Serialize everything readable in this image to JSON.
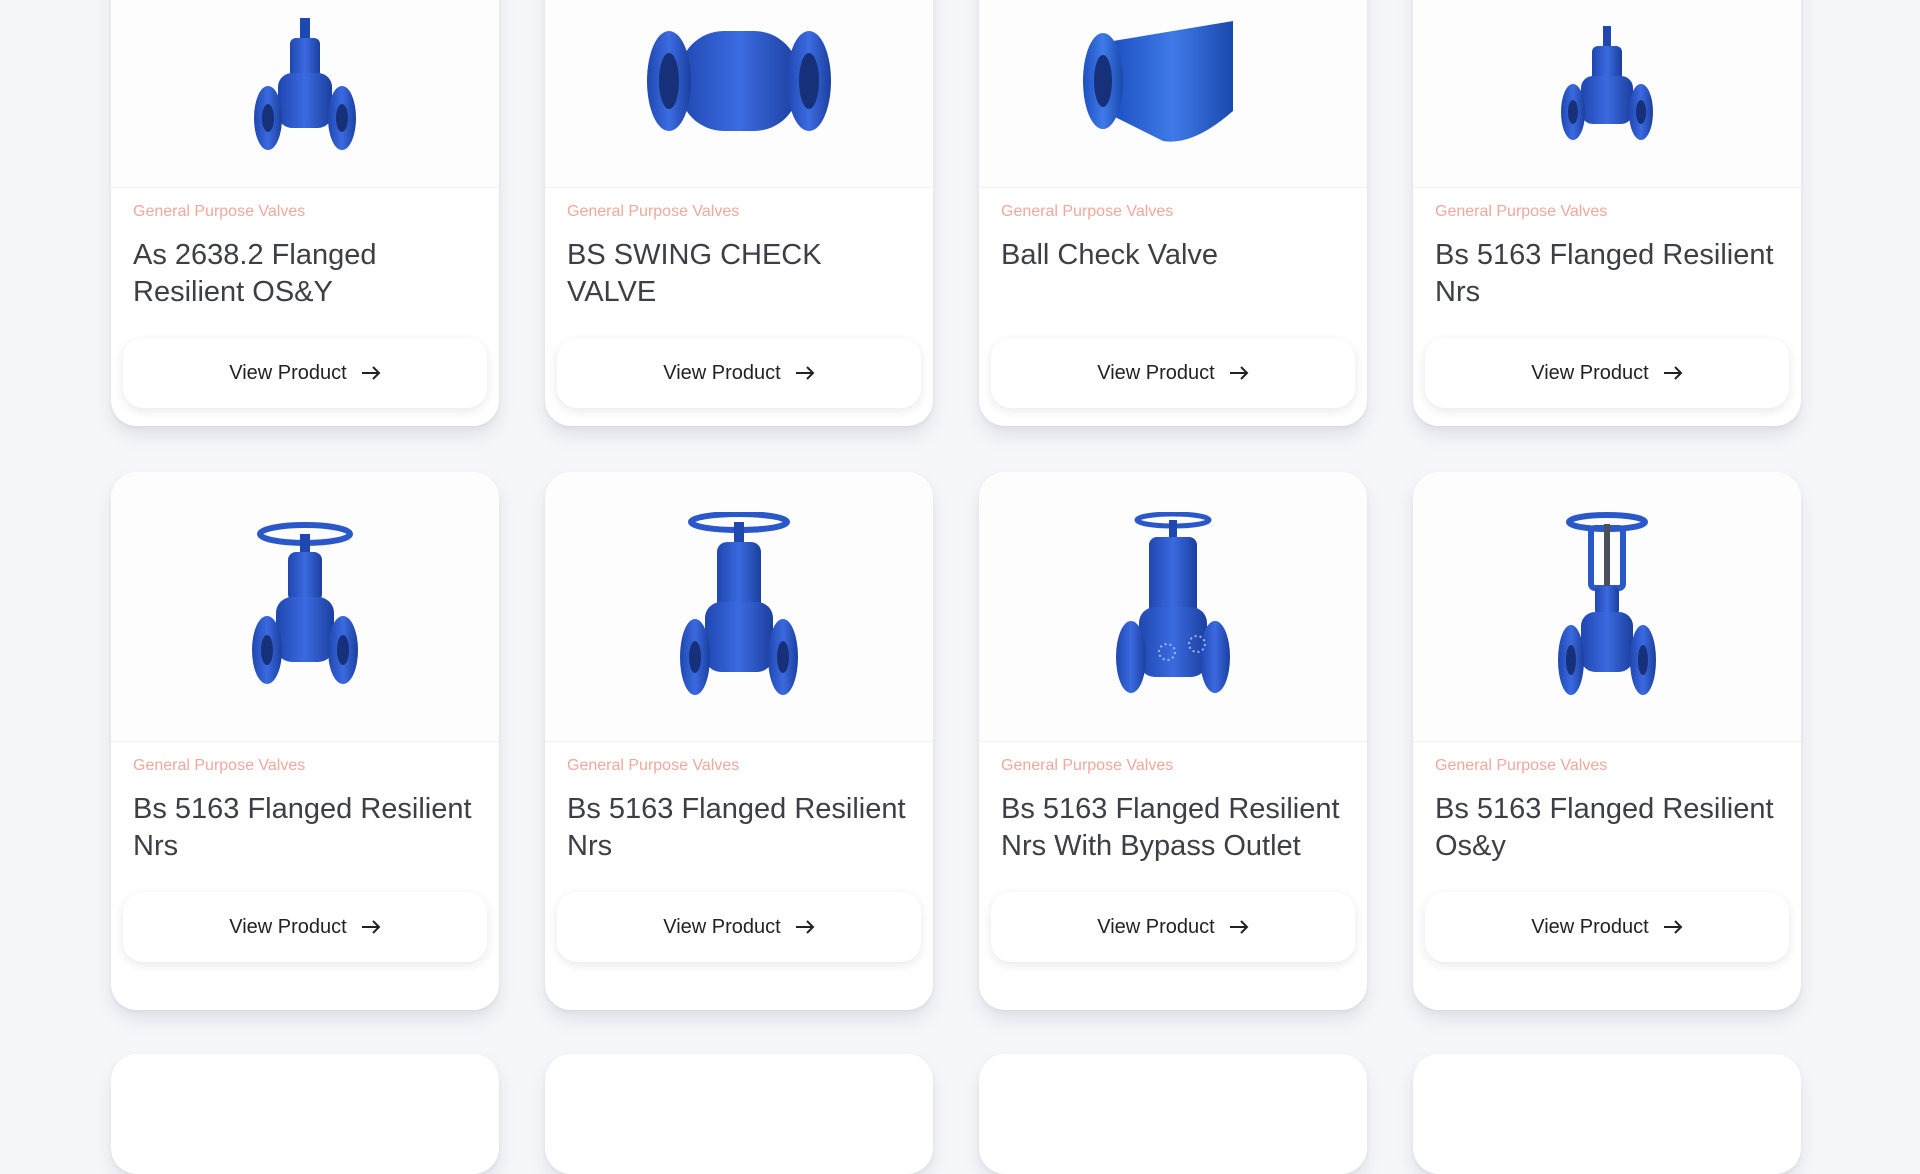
{
  "colors": {
    "page_bg": "#f6f7fa",
    "category": "#f0a89c",
    "title": "#3d3f47",
    "valve_blue": "#2b58c9"
  },
  "product_grid": {
    "button_label": "View Product",
    "button_icon": "arrow-right-icon",
    "products": [
      {
        "category": "General Purpose Valves",
        "title": "As 2638.2 Flanged Resilient OS&Y",
        "image": "gate-valve-icon"
      },
      {
        "category": "General Purpose Valves",
        "title": "BS SWING CHECK VALVE",
        "image": "swing-check-valve-icon"
      },
      {
        "category": "General Purpose Valves",
        "title": "Ball Check Valve",
        "image": "ball-check-valve-icon"
      },
      {
        "category": "General Purpose Valves",
        "title": "Bs 5163 Flanged Resilient Nrs",
        "image": "gate-valve-icon"
      },
      {
        "category": "General Purpose Valves",
        "title": "Bs 5163 Flanged Resilient Nrs",
        "image": "gate-valve-icon"
      },
      {
        "category": "General Purpose Valves",
        "title": "Bs 5163 Flanged Resilient Nrs",
        "image": "gate-valve-icon"
      },
      {
        "category": "General Purpose Valves",
        "title": "Bs 5163 Flanged Resilient Nrs With Bypass Outlet",
        "image": "bypass-gate-valve-icon"
      },
      {
        "category": "General Purpose Valves",
        "title": "Bs 5163 Flanged Resilient Os&y",
        "image": "rising-stem-gate-valve-icon"
      }
    ]
  }
}
